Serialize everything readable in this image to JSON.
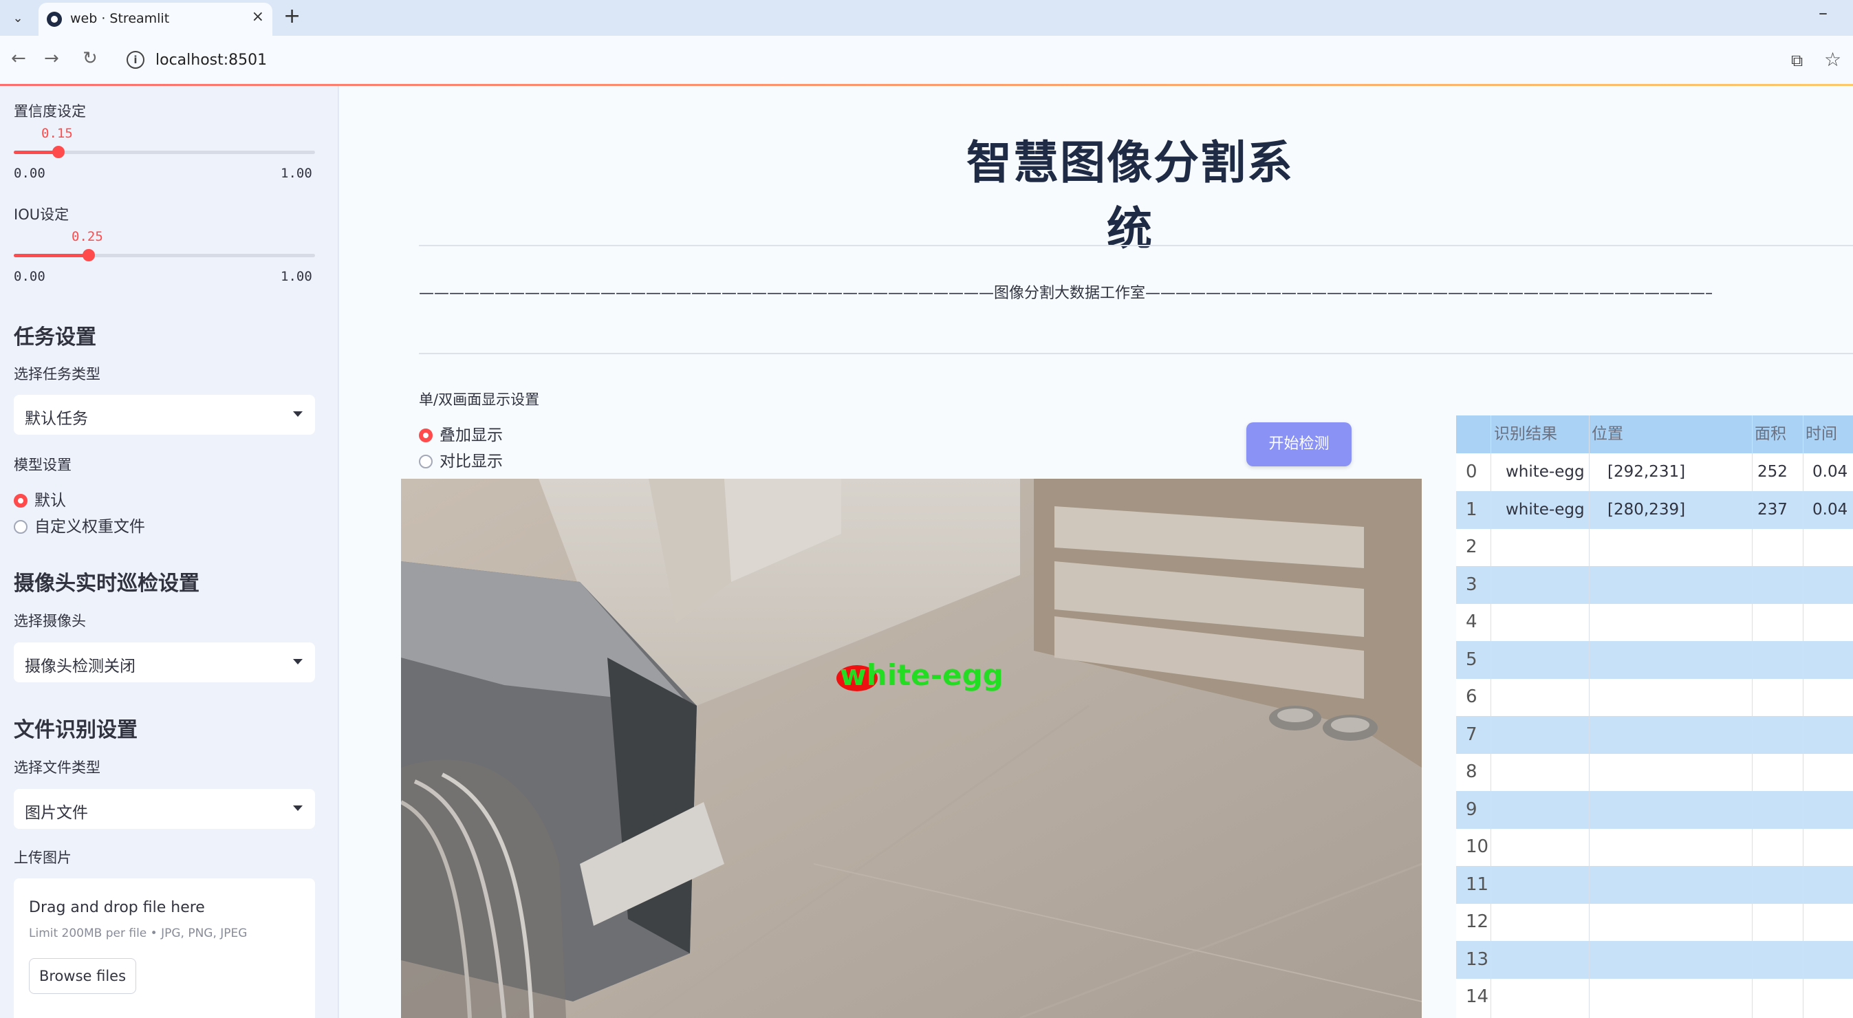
{
  "browser": {
    "tab_title": "web · Streamlit",
    "url": "localhost:8501",
    "new_tab": "+",
    "close": "×",
    "minimize": "–"
  },
  "sidebar": {
    "confidence": {
      "label": "置信度设定",
      "value": "0.15",
      "min": "0.00",
      "max": "1.00",
      "fraction": 0.15
    },
    "iou": {
      "label": "IOU设定",
      "value": "0.25",
      "min": "0.00",
      "max": "1.00",
      "fraction": 0.25
    },
    "task_header": "任务设置",
    "task_type_label": "选择任务类型",
    "task_type_value": "默认任务",
    "model_label": "模型设置",
    "model_options": [
      "默认",
      "自定义权重文件"
    ],
    "model_selected": 0,
    "camera_header": "摄像头实时巡检设置",
    "camera_label": "选择摄像头",
    "camera_value": "摄像头检测关闭",
    "file_header": "文件识别设置",
    "file_type_label": "选择文件类型",
    "file_type_value": "图片文件",
    "upload_label": "上传图片",
    "upload": {
      "title": "Drag and drop file here",
      "limit": "Limit 200MB per file • JPG, PNG, JPEG",
      "browse": "Browse files"
    }
  },
  "main": {
    "title": "智慧图像分割系统",
    "subtitle": "——————————————————————————————————————图像分割大数据工作室——————————————————————————————————————",
    "display_label": "单/双画面显示设置",
    "display_options": [
      "叠加显示",
      "对比显示"
    ],
    "display_selected": 0,
    "start_button": "开始检测",
    "detection_label": "white-egg"
  },
  "table": {
    "columns": [
      "识别结果",
      "位置",
      "面积",
      "时间"
    ],
    "rows": [
      {
        "idx": "0",
        "result": "white-egg",
        "position": "[292,231]",
        "area": "252",
        "time": "0.04"
      },
      {
        "idx": "1",
        "result": "white-egg",
        "position": "[280,239]",
        "area": "237",
        "time": "0.04"
      },
      {
        "idx": "2"
      },
      {
        "idx": "3"
      },
      {
        "idx": "4"
      },
      {
        "idx": "5"
      },
      {
        "idx": "6"
      },
      {
        "idx": "7"
      },
      {
        "idx": "8"
      },
      {
        "idx": "9"
      },
      {
        "idx": "10"
      },
      {
        "idx": "11"
      },
      {
        "idx": "12"
      },
      {
        "idx": "13"
      },
      {
        "idx": "14"
      }
    ]
  },
  "colors": {
    "accent": "#ff4b4b",
    "button": "#8a93f5",
    "table_header": "#a9d2f5",
    "table_alt": "#c7e1f8",
    "detection_text": "#22dd22",
    "detection_mask": "#ee1111"
  },
  "icons": [
    "chevron-down-icon",
    "streamlit-icon",
    "close-icon",
    "plus-icon",
    "back-icon",
    "forward-icon",
    "reload-icon",
    "info-icon",
    "translate-icon",
    "star-icon"
  ]
}
